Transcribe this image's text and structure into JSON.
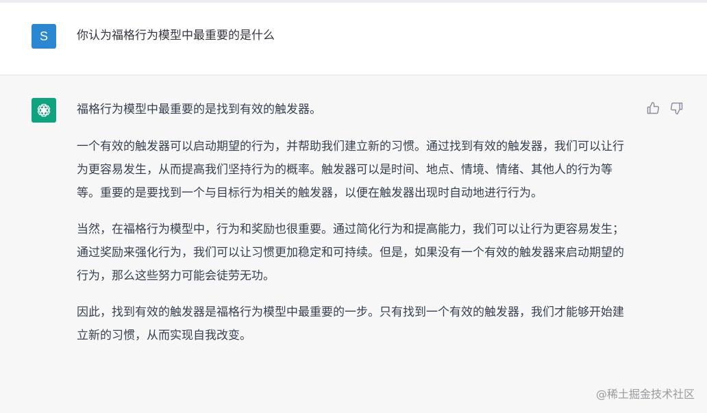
{
  "user_message": {
    "avatar_letter": "S",
    "text": "你认为福格行为模型中最重要的是什么"
  },
  "assistant_message": {
    "paragraphs": [
      "福格行为模型中最重要的是找到有效的触发器。",
      "一个有效的触发器可以启动期望的行为，并帮助我们建立新的习惯。通过找到有效的触发器，我们可以让行为更容易发生，从而提高我们坚持行为的概率。触发器可以是时间、地点、情境、情绪、其他人的行为等等。重要的是要找到一个与目标行为相关的触发器，以便在触发器出现时自动地进行行为。",
      "当然，在福格行为模型中，行为和奖励也很重要。通过简化行为和提高能力，我们可以让行为更容易发生；通过奖励来强化行为，我们可以让习惯更加稳定和可持续。但是，如果没有一个有效的触发器来启动期望的行为，那么这些努力可能会徒劳无功。",
      "因此，找到有效的触发器是福格行为模型中最重要的一步。只有找到一个有效的触发器，我们才能够开始建立新的习惯，从而实现自我改变。"
    ]
  },
  "icons": {
    "assistant_avatar": "openai-logo-icon",
    "thumbs_up": "thumbs-up-icon",
    "thumbs_down": "thumbs-down-icon"
  },
  "colors": {
    "user_avatar_bg": "#2b87d1",
    "assistant_avatar_bg": "#10a37f",
    "assistant_row_bg": "#f7f7f8"
  },
  "watermark": "@稀土掘金技术社区"
}
